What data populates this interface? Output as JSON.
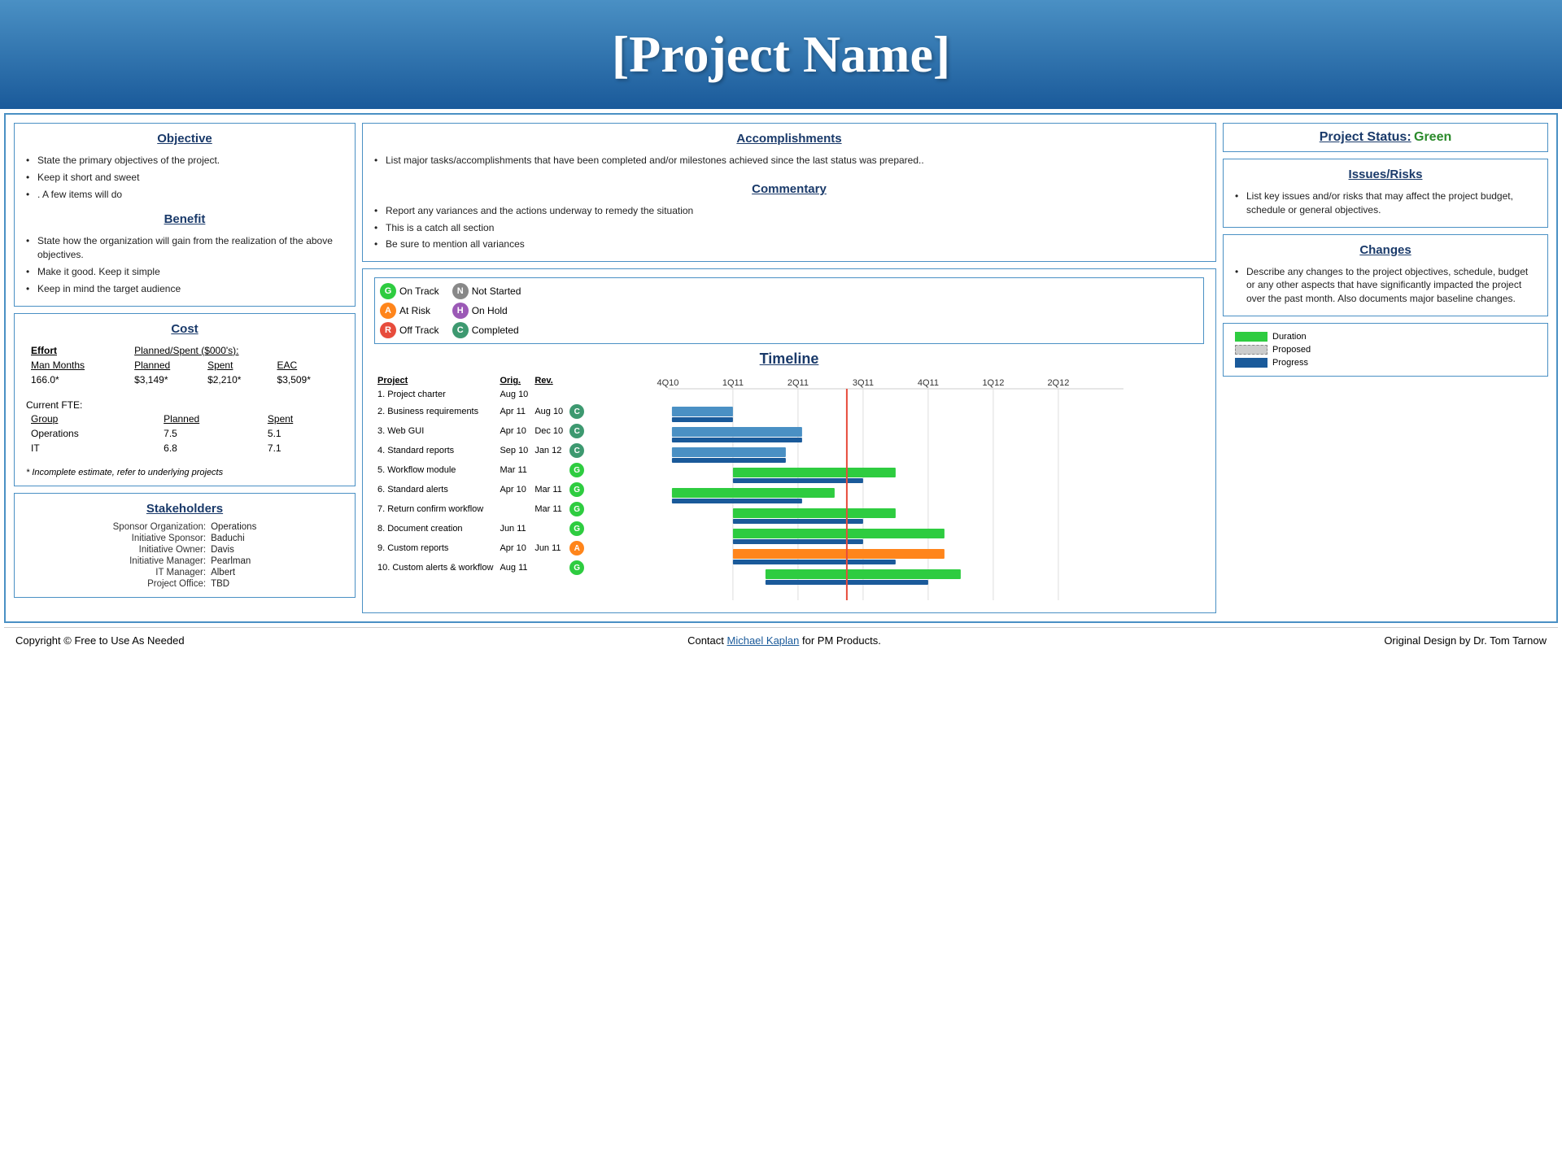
{
  "header": {
    "title": "[Project Name]"
  },
  "objective": {
    "title": "Objective",
    "items": [
      "State the primary objectives of the project.",
      "Keep it short and sweet",
      ".  A few items will do"
    ]
  },
  "benefit": {
    "title": "Benefit",
    "items": [
      "State how the organization will gain from the realization of the above  objectives.",
      "Make it good. Keep it simple",
      "Keep in mind the target audience"
    ]
  },
  "cost": {
    "title": "Cost",
    "effort_label": "Effort",
    "planned_spent_label": "Planned/Spent ($000's):",
    "columns": [
      "Man Months",
      "Planned",
      "Spent",
      "EAC"
    ],
    "values": [
      "166.0*",
      "$3,149*",
      "$2,210*",
      "$3,509*"
    ],
    "fte_label": "Current FTE:",
    "fte_columns": [
      "Group",
      "Planned",
      "Spent"
    ],
    "fte_rows": [
      [
        "Operations",
        "7.5",
        "5.1"
      ],
      [
        "IT",
        "6.8",
        "7.1"
      ]
    ],
    "footnote": "* Incomplete estimate, refer to underlying projects"
  },
  "stakeholders": {
    "title": "Stakeholders",
    "rows": [
      {
        "label": "Sponsor Organization:",
        "value": "Operations"
      },
      {
        "label": "Initiative Sponsor:",
        "value": "Baduchi"
      },
      {
        "label": "Initiative Owner:",
        "value": "Davis"
      },
      {
        "label": "Initiative Manager:",
        "value": "Pearlman"
      },
      {
        "label": "IT Manager:",
        "value": "Albert"
      },
      {
        "label": "Project Office:",
        "value": "TBD"
      }
    ]
  },
  "accomplishments": {
    "title": "Accomplishments",
    "items": [
      "List major tasks/accomplishments that have  been completed and/or milestones achieved  since the last status was prepared.."
    ]
  },
  "commentary": {
    "title": "Commentary",
    "items": [
      "Report any variances  and the actions underway to remedy the situation",
      "This is a catch all section",
      "Be  sure to mention all variances"
    ]
  },
  "project_status": {
    "title": "Project Status:",
    "value": "Green"
  },
  "issues_risks": {
    "title": "Issues/Risks",
    "items": [
      "List key issues and/or risks that may affect the project budget, schedule or general objectives."
    ]
  },
  "changes": {
    "title": "Changes",
    "items": [
      "Describe any changes to the project objectives, schedule, budget or any other aspects that have significantly impacted the project over the past month. Also documents major baseline changes."
    ]
  },
  "timeline": {
    "title": "Timeline",
    "legend_status": [
      {
        "letter": "G",
        "color": "#2ecc40",
        "label": "On Track"
      },
      {
        "letter": "N",
        "color": "#888",
        "label": "Not Started"
      },
      {
        "letter": "A",
        "color": "#ff851b",
        "label": "At Risk"
      },
      {
        "letter": "H",
        "color": "#9b59b6",
        "label": "On Hold"
      },
      {
        "letter": "R",
        "color": "#e74c3c",
        "label": "Off Track"
      },
      {
        "letter": "C",
        "color": "#3d9970",
        "label": "Completed"
      }
    ],
    "legend_bar": [
      {
        "color": "#2ecc40",
        "label": "Duration"
      },
      {
        "color": "#ddd",
        "label": "Proposed",
        "dashed": true
      },
      {
        "color": "#1a5a9a",
        "label": "Progress"
      }
    ],
    "projects": [
      {
        "name": "1. Project charter",
        "orig": "Aug 10",
        "rev": "",
        "status": "",
        "duration_start": 0,
        "duration_end": 0,
        "progress_start": 0,
        "progress_end": 0
      },
      {
        "name": "2. Business requirements",
        "orig": "Apr 11",
        "rev": "Aug 10",
        "status": "C",
        "duration_start": 1,
        "duration_end": 3,
        "progress_start": 1,
        "progress_end": 3
      },
      {
        "name": "3. Web GUI",
        "orig": "Apr 10",
        "rev": "Dec 10",
        "status": "C",
        "duration_start": 1,
        "duration_end": 5,
        "progress_start": 1,
        "progress_end": 5
      },
      {
        "name": "4. Standard reports",
        "orig": "Sep 10",
        "rev": "Jan 12",
        "status": "C",
        "duration_start": 1,
        "duration_end": 4,
        "progress_start": 1,
        "progress_end": 4
      },
      {
        "name": "5. Workflow module",
        "orig": "Mar 11",
        "rev": "",
        "status": "G",
        "duration_start": 2,
        "duration_end": 5,
        "progress_start": 2,
        "progress_end": 4
      },
      {
        "name": "6. Standard alerts",
        "orig": "Apr 10",
        "rev": "Mar 11",
        "status": "G",
        "duration_start": 1,
        "duration_end": 5,
        "progress_start": 1,
        "progress_end": 4
      },
      {
        "name": "7. Return confirm workflow",
        "orig": "",
        "rev": "Mar 11",
        "status": "G",
        "duration_start": 2,
        "duration_end": 5,
        "progress_start": 2,
        "progress_end": 4
      },
      {
        "name": "8. Document creation",
        "orig": "Jun 11",
        "rev": "",
        "status": "G",
        "duration_start": 2,
        "duration_end": 6,
        "progress_start": 2,
        "progress_end": 4
      },
      {
        "name": "9. Custom reports",
        "orig": "Apr 10",
        "rev": "Jun 11",
        "status": "A",
        "duration_start": 2,
        "duration_end": 6,
        "progress_start": 2,
        "progress_end": 5
      },
      {
        "name": "10. Custom alerts & workflow",
        "orig": "Aug 11",
        "rev": "",
        "status": "G",
        "duration_start": 3,
        "duration_end": 6,
        "progress_start": 3,
        "progress_end": 5
      }
    ],
    "quarters": [
      "4Q10",
      "1Q11",
      "2Q11",
      "3Q11",
      "4Q11",
      "1Q12",
      "2Q12"
    ]
  },
  "footer": {
    "left": "Copyright © Free to  Use As Needed",
    "middle_prefix": "Contact ",
    "middle_link": "Michael Kaplan",
    "middle_suffix": " for PM Products.",
    "right": "Original Design by Dr. Tom Tarnow"
  }
}
